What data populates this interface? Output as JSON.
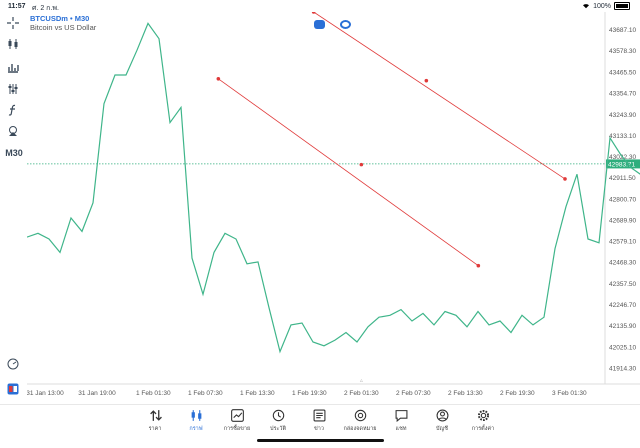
{
  "status": {
    "time": "11:57",
    "date": "ศ. 2 ก.พ.",
    "battery": "100%"
  },
  "toolbar": {
    "timeframe_button": "M30"
  },
  "chart_header": {
    "symbol": "BTCUSDm • M30",
    "description": "Bitcoin vs US Dollar"
  },
  "colors": {
    "price_line": "#3fb58a",
    "trendline": "#e03a3a",
    "accent": "#2a6fd6",
    "current_price_bg": "#2fae7d"
  },
  "chart_data": {
    "type": "line",
    "ylim": [
      41830,
      43780
    ],
    "y_ticks": [
      "43687.10",
      "43578.30",
      "43465.50",
      "43354.70",
      "43243.90",
      "43133.10",
      "43022.30",
      "42911.50",
      "42800.70",
      "42689.90",
      "42579.10",
      "42468.30",
      "42357.50",
      "42246.70",
      "42135.90",
      "42025.10",
      "41914.30"
    ],
    "x_ticks": [
      "31 Jan 13:00",
      "31 Jan 19:00",
      "1 Feb 01:30",
      "1 Feb 07:30",
      "1 Feb 13:30",
      "1 Feb 19:30",
      "2 Feb 01:30",
      "2 Feb 07:30",
      "2 Feb 13:30",
      "2 Feb 19:30",
      "3 Feb 01:30"
    ],
    "current_price": "42983.71",
    "series": [
      {
        "values": [
          42600,
          42620,
          42590,
          42520,
          42700,
          42630,
          42780,
          43300,
          43450,
          43450,
          43580,
          43720,
          43640,
          43200,
          43280,
          42490,
          42300,
          42520,
          42620,
          42590,
          42460,
          42470,
          42230,
          42000,
          42140,
          42150,
          42050,
          42030,
          42060,
          42100,
          42050,
          42130,
          42180,
          42190,
          42220,
          42160,
          42200,
          42140,
          42210,
          42190,
          42130,
          42210,
          42140,
          42160,
          42100,
          42190,
          42140,
          42180,
          42540,
          42760,
          42930,
          42590,
          42570,
          43120,
          43030,
          42960,
          42920,
          42950,
          43230,
          43080,
          43060,
          43020,
          42970,
          42950,
          43050,
          42970,
          43010,
          43240,
          43160,
          43220,
          43040,
          43080,
          43030,
          43050,
          43010,
          42990
        ]
      }
    ],
    "trendlines": [
      {
        "points": [
          {
            "x": "1 Feb 09:00",
            "y": 43430
          },
          {
            "x": "2 Feb 01:30",
            "y": 42980
          },
          {
            "x": "2 Feb 15:00",
            "y": 42450
          }
        ]
      },
      {
        "points": [
          {
            "x": "1 Feb 20:00",
            "y": 43780
          },
          {
            "x": "2 Feb 09:00",
            "y": 43420
          },
          {
            "x": "3 Feb 01:00",
            "y": 42905
          }
        ]
      }
    ]
  },
  "bottom_nav": [
    {
      "label": "ราคา",
      "icon": "quotes-icon",
      "active": false
    },
    {
      "label": "กราฟ",
      "icon": "chart-icon",
      "active": true
    },
    {
      "label": "การซื้อขาย",
      "icon": "trade-icon",
      "active": false
    },
    {
      "label": "ประวัติ",
      "icon": "history-icon",
      "active": false
    },
    {
      "label": "ข่าว",
      "icon": "news-icon",
      "active": false
    },
    {
      "label": "กล่องจดหมาย",
      "icon": "mailbox-icon",
      "active": false
    },
    {
      "label": "แชท",
      "icon": "chat-icon",
      "active": false
    },
    {
      "label": "บัญชี",
      "icon": "account-icon",
      "active": false
    },
    {
      "label": "การตั้งค่า",
      "icon": "settings-icon",
      "active": false
    }
  ]
}
